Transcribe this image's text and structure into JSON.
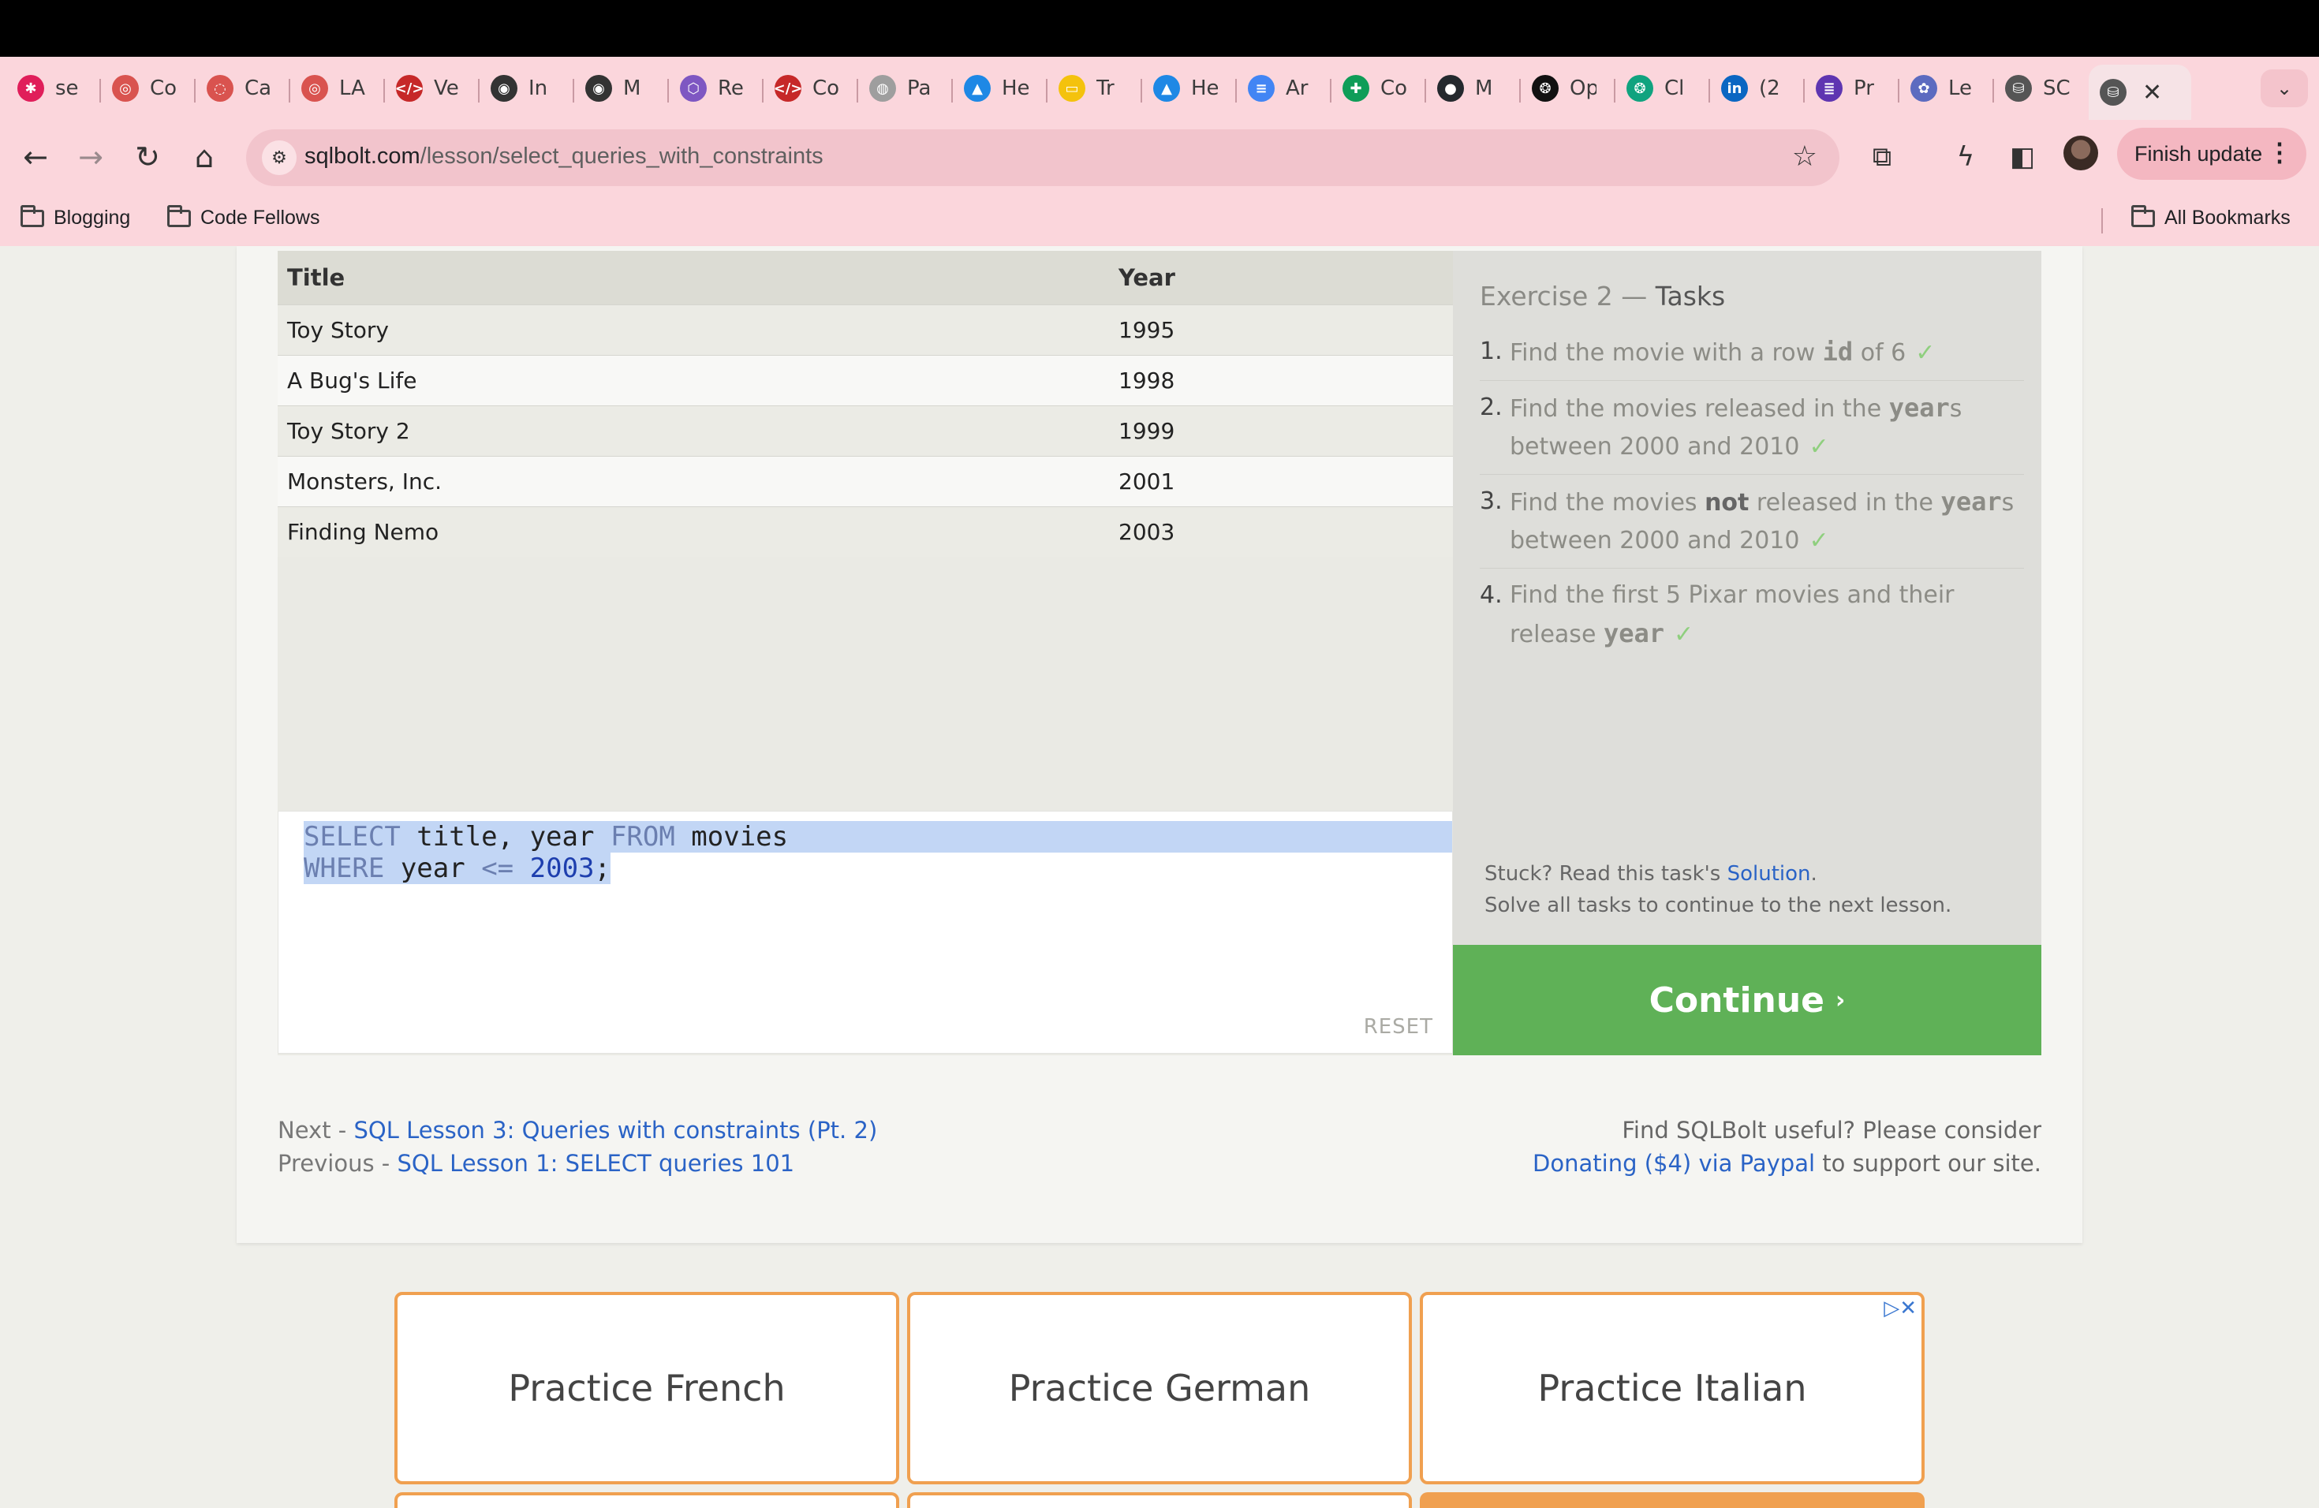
{
  "tabs": [
    {
      "label": "se",
      "color": "#e01e5a",
      "glyph": "✱"
    },
    {
      "label": "Co",
      "color": "#d9534f",
      "glyph": "◎"
    },
    {
      "label": "Ca",
      "color": "#d9534f",
      "glyph": "◌"
    },
    {
      "label": "LA",
      "color": "#d9534f",
      "glyph": "◎"
    },
    {
      "label": "Ve",
      "color": "#c62828",
      "glyph": "</>"
    },
    {
      "label": "In",
      "color": "#333333",
      "glyph": "◉"
    },
    {
      "label": "M",
      "color": "#333333",
      "glyph": "◉"
    },
    {
      "label": "Re",
      "color": "#7e57c2",
      "glyph": "⬡"
    },
    {
      "label": "Co",
      "color": "#c62828",
      "glyph": "</>"
    },
    {
      "label": "Pa",
      "color": "#9e9e9e",
      "glyph": "◍"
    },
    {
      "label": "He",
      "color": "#1e88e5",
      "glyph": "▲"
    },
    {
      "label": "Tr",
      "color": "#f4c20d",
      "glyph": "▭"
    },
    {
      "label": "He",
      "color": "#1e88e5",
      "glyph": "▲"
    },
    {
      "label": "Ar",
      "color": "#4285f4",
      "glyph": "≡"
    },
    {
      "label": "Co",
      "color": "#0f9d58",
      "glyph": "✚"
    },
    {
      "label": "M",
      "color": "#24292e",
      "glyph": "●"
    },
    {
      "label": "Op",
      "color": "#111111",
      "glyph": "❂"
    },
    {
      "label": "Cl",
      "color": "#10a37f",
      "glyph": "❂"
    },
    {
      "label": "(2",
      "color": "#0a66c2",
      "glyph": "in"
    },
    {
      "label": "Pr",
      "color": "#5e35b1",
      "glyph": "≣"
    },
    {
      "label": "Le",
      "color": "#5c6bc0",
      "glyph": "✿"
    },
    {
      "label": "SC",
      "color": "#555555",
      "glyph": "⛁"
    },
    {
      "label": "",
      "color": "#555555",
      "glyph": "⛁"
    }
  ],
  "address": {
    "host": "sqlbolt.com",
    "path": "/lesson/select_queries_with_constraints"
  },
  "toolbar": {
    "update_label": "Finish update"
  },
  "bookmarks": {
    "item1": "Blogging",
    "item2": "Code Fellows",
    "all": "All Bookmarks"
  },
  "results": {
    "headers": [
      "Title",
      "Year"
    ],
    "rows": [
      [
        "Toy Story",
        "1995"
      ],
      [
        "A Bug's Life",
        "1998"
      ],
      [
        "Toy Story 2",
        "1999"
      ],
      [
        "Monsters, Inc.",
        "2001"
      ],
      [
        "Finding Nemo",
        "2003"
      ]
    ]
  },
  "editor": {
    "line1": {
      "kw1": "SELECT",
      "t1": " title, year ",
      "kw2": "FROM",
      "t2": " movies"
    },
    "line2": {
      "kw1": "WHERE",
      "t1": " year ",
      "op": "<=",
      "sp": " ",
      "num": "2003",
      "end": ";"
    },
    "reset": "RESET"
  },
  "tasks": {
    "title_prefix": "Exercise 2 — ",
    "title_bold": "Tasks",
    "items": [
      {
        "n": "1.",
        "a": "Find the movie with a row ",
        "code": "id",
        "b": " of 6",
        "c": ""
      },
      {
        "n": "2.",
        "a": "Find the movies released in the ",
        "code": "year",
        "b": "s between 2000 and 2010",
        "c": ""
      },
      {
        "n": "3.",
        "a": "Find the movies ",
        "strong": "not",
        "a2": " released in the ",
        "code": "year",
        "b": "s between 2000 and 2010"
      },
      {
        "n": "4.",
        "a": "Find the first 5 Pixar movies and their release ",
        "code": "year",
        "b": ""
      }
    ],
    "check": "✓",
    "stuck_prefix": "Stuck? Read this task's ",
    "stuck_link": "Solution",
    "stuck_suffix": ".",
    "solve_all": "Solve all tasks to continue to the next lesson."
  },
  "continue": {
    "label": "Continue",
    "arrow": "›"
  },
  "footer": {
    "next_prefix": "Next - ",
    "next_link": "SQL Lesson 3: Queries with constraints (Pt. 2)",
    "prev_prefix": "Previous - ",
    "prev_link": "SQL Lesson 1: SELECT queries 101",
    "donate_line1": "Find SQLBolt useful? Please consider",
    "donate_link": "Donating ($4) via Paypal",
    "donate_suffix": " to support our site."
  },
  "ads": [
    "Practice French",
    "Practice German",
    "Practice Italian"
  ],
  "colors": {
    "accent": "#5fb157",
    "link": "#2a63c6",
    "chrome": "#fbd6dc",
    "ad_border": "#f0a050"
  }
}
